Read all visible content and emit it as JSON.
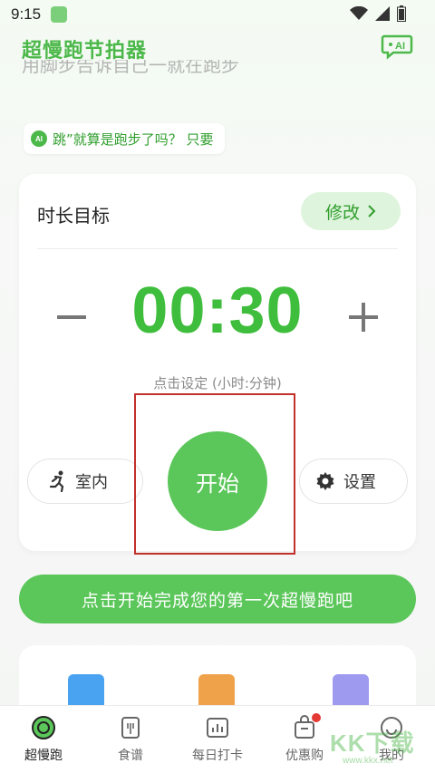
{
  "status_bar": {
    "time": "9:15",
    "icons": [
      "app-notification-icon",
      "wifi-icon",
      "signal-icon",
      "battery-icon"
    ]
  },
  "header": {
    "title": "超慢跑节拍器",
    "ai_button_label": "AI",
    "ai_icon": "ai-chat-icon"
  },
  "scrolled_text": "用脚步告诉自己一就在跑步",
  "ai_tip": {
    "badge": "AI",
    "text": "跳”就算是跑步了吗？ 只要"
  },
  "goal_card": {
    "title": "时长目标",
    "edit_label": "修改",
    "edit_icon": "chevron-right-icon",
    "decrease_icon": "minus-icon",
    "increase_icon": "plus-icon",
    "timer_value": "00:30",
    "hint": "点击设定 (小时:分钟)",
    "indoor_label": "室内",
    "indoor_icon": "runner-icon",
    "start_label": "开始",
    "settings_label": "设置",
    "settings_icon": "gear-icon"
  },
  "cta": {
    "label": "点击开始完成您的第一次超慢跑吧"
  },
  "tools": [
    {
      "icon": "running-tool-icon"
    },
    {
      "icon": "metronome-tool-icon"
    },
    {
      "icon": "list-tool-icon"
    }
  ],
  "tabbar": {
    "items": [
      {
        "label": "超慢跑",
        "icon": "run-tab-icon",
        "active": true
      },
      {
        "label": "食谱",
        "icon": "recipe-tab-icon",
        "active": false
      },
      {
        "label": "每日打卡",
        "icon": "checkin-tab-icon",
        "active": false
      },
      {
        "label": "优惠购",
        "icon": "shop-tab-icon",
        "active": false,
        "badge": true
      },
      {
        "label": "我的",
        "icon": "profile-tab-icon",
        "active": false
      }
    ]
  },
  "watermark": {
    "text": "KK下载",
    "url": "www.kkx.net"
  },
  "colors": {
    "accent": "#4cb84a",
    "button_green": "#5bc65a",
    "light_green": "#dff4dc",
    "highlight_red": "#c2302c"
  }
}
